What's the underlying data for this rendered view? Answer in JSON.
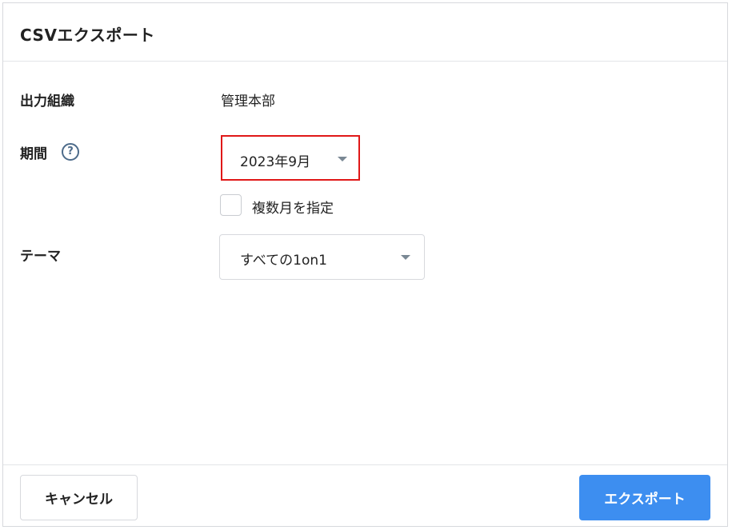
{
  "dialog": {
    "title": "CSVエクスポート"
  },
  "form": {
    "organization": {
      "label": "出力組織",
      "value": "管理本部"
    },
    "period": {
      "label": "期間",
      "help_icon": "question-circle-icon",
      "selected": "2023年9月",
      "multi_month_checkbox": {
        "label": "複数月を指定",
        "checked": false
      }
    },
    "theme": {
      "label": "テーマ",
      "selected": "すべての1on1"
    }
  },
  "footer": {
    "cancel_label": "キャンセル",
    "export_label": "エクスポート"
  },
  "colors": {
    "primary": "#3d8ef0",
    "highlight_border": "#e01818",
    "help_icon": "#4d6b8a"
  }
}
